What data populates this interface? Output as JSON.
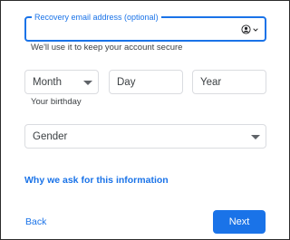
{
  "recovery_email": {
    "label": "Recovery email address (optional)",
    "value": "",
    "helper": "We'll use it to keep your account secure",
    "icon": "account-circle-icon"
  },
  "birthday": {
    "month_placeholder": "Month",
    "day_placeholder": "Day",
    "year_placeholder": "Year",
    "helper": "Your birthday"
  },
  "gender": {
    "placeholder": "Gender"
  },
  "info_link": "Why we ask for this information",
  "actions": {
    "back_label": "Back",
    "next_label": "Next"
  },
  "colors": {
    "accent": "#1a73e8",
    "border": "#dadce0",
    "text": "#3c4043"
  }
}
